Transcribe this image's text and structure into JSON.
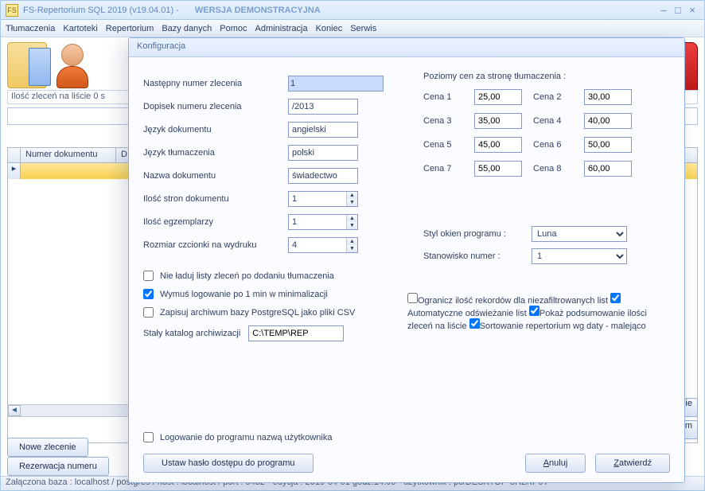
{
  "titlebar": {
    "icon_text": "FS",
    "title": "FS-Repertorium SQL 2019  (v19.04.01)    -",
    "demo": "WERSJA DEMONSTRACYJNA"
  },
  "menu": {
    "items": [
      "Tłumaczenia",
      "Kartoteki",
      "Repertorium",
      "Bazy danych",
      "Pomoc",
      "Administracja",
      "Koniec",
      "Serwis"
    ]
  },
  "background": {
    "status": "Ilość zleceń na liście 0 s",
    "grid_headers": [
      "Numer dokumentu",
      "D"
    ],
    "bottom_buttons": {
      "new": "Nowe zlecenie",
      "reserve": "Rezerwacja numeru"
    },
    "edgebtn1": "wanie",
    "edgebtn2": "rogram"
  },
  "statusbar": {
    "text": "Załączona baza : localhost  /  postgres  /  host : localhost  /  port : 5432  -    edycja : 2019-04-01  godz.14:00    -   użytkownik : pc/DESKTOP-5H2RP6T"
  },
  "modal": {
    "title": "Konfiguracja",
    "fields": {
      "next_num_label": "Następny numer zlecenia",
      "next_num": "1",
      "suffix_label": "Dopisek numeru zlecenia",
      "suffix": "/2013",
      "doc_lang_label": "Język dokumentu",
      "doc_lang": "angielski",
      "tr_lang_label": "Język tłumaczenia",
      "tr_lang": "polski",
      "doc_name_label": "Nazwa dokumentu",
      "doc_name": "świadectwo",
      "pages_label": "Ilość stron dokumentu",
      "pages": "1",
      "copies_label": "Ilość egzemplarzy",
      "copies": "1",
      "font_label": "Rozmiar czcionki na wydruku",
      "font": "4"
    },
    "prices": {
      "title": "Poziomy cen za stronę tłumaczenia :",
      "labels": [
        "Cena 1",
        "Cena 2",
        "Cena 3",
        "Cena 4",
        "Cena 5",
        "Cena 6",
        "Cena 7",
        "Cena 8"
      ],
      "values": [
        "25,00",
        "30,00",
        "35,00",
        "40,00",
        "45,00",
        "50,00",
        "55,00",
        "60,00"
      ]
    },
    "style": {
      "style_label": "Styl okien programu :",
      "style_value": "Luna",
      "station_label": "Stanowisko numer :",
      "station_value": "1"
    },
    "checks_left": {
      "c1": {
        "checked": false,
        "label": "Nie ładuj listy zleceń po dodaniu tłumaczenia"
      },
      "c2": {
        "checked": true,
        "label": "Wymuś logowanie po 1 min w minimalizacji"
      },
      "c3": {
        "checked": false,
        "label": "Zapisuj archiwum bazy PostgreSQL jako pliki CSV"
      }
    },
    "archive": {
      "label": "Stały katalog archiwizacji",
      "value": "C:\\TEMP\\REP"
    },
    "checks_right": {
      "c1": {
        "checked": false,
        "label": "Ogranicz ilość rekordów dla niezafiltrowanych list"
      },
      "c2": {
        "checked": true,
        "label": "Automatyczne odświeżanie list"
      },
      "c3": {
        "checked": true,
        "label": "Pokaż podsumowanie ilości zleceń na liście"
      },
      "c4": {
        "checked": true,
        "label": "Sortowanie repertorium wg daty - malejąco"
      }
    },
    "login_check": {
      "checked": false,
      "label": "Logowanie do programu nazwą użytkownika"
    },
    "buttons": {
      "password": "Ustaw hasło dostępu do programu",
      "cancel": "Anuluj",
      "confirm": "Zatwierdź"
    },
    "ul": {
      "new": "N",
      "reserve": "R",
      "pass": "U",
      "cancel": "A",
      "confirm": "Z"
    }
  }
}
